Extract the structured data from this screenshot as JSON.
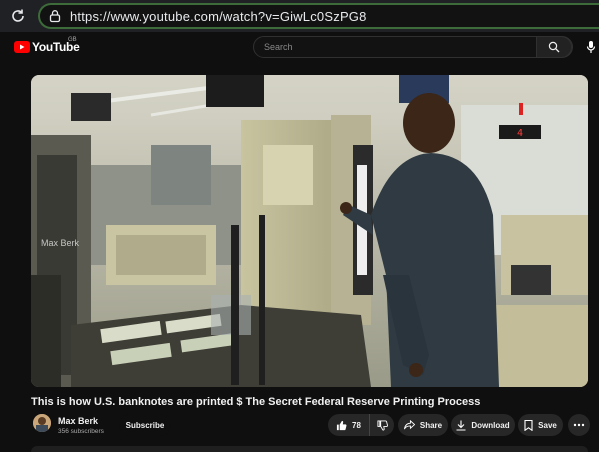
{
  "browser": {
    "url_scheme": "https://",
    "url_host": "www.youtube.com",
    "url_path": "/watch?v=GiwLc0SzPG8"
  },
  "header": {
    "logo_text": "YouTube",
    "country_code": "GB",
    "search_placeholder": "Search"
  },
  "video": {
    "watermark": "Max Berk",
    "title": "This is how U.S. banknotes are printed $ The Secret Federal Reserve Printing Process"
  },
  "channel": {
    "name": "Max Berk",
    "subscribers": "356 subscribers",
    "subscribe_label": "Subscribe"
  },
  "actions": {
    "like_count": "78",
    "share_label": "Share",
    "download_label": "Download",
    "save_label": "Save"
  },
  "icons": [
    "reload-icon",
    "site-info-icon",
    "youtube-logo-icon",
    "search-icon",
    "mic-icon",
    "thumbs-up-icon",
    "thumbs-down-icon",
    "share-icon",
    "download-icon",
    "save-icon",
    "more-icon"
  ],
  "colors": {
    "accent_red": "#ff0000",
    "url_border": "#3d6b3a",
    "background": "#0f0f0f",
    "pill": "#272727"
  }
}
